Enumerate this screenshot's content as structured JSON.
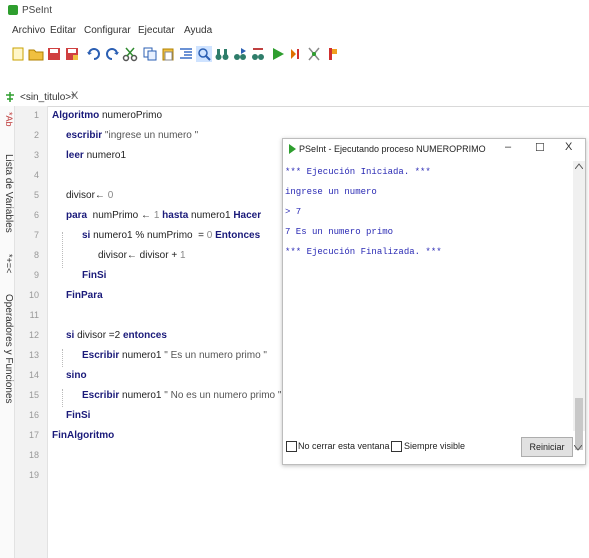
{
  "app": {
    "title": "PSeInt"
  },
  "menu": [
    "Archivo",
    "Editar",
    "Configurar",
    "Ejecutar",
    "Ayuda"
  ],
  "tab": {
    "label": "<sin_titulo>*",
    "close": "X"
  },
  "side_panels": {
    "variables": "Lista de Variables",
    "operators": "Operadores y Funciones"
  },
  "editor": {
    "line_numbers": [
      "1",
      "2",
      "3",
      "4",
      "5",
      "6",
      "7",
      "8",
      "9",
      "10",
      "11",
      "12",
      "13",
      "14",
      "15",
      "16",
      "17",
      "18",
      "19"
    ],
    "lines": [
      {
        "kw1": "Algoritmo",
        "text": " numeroPrimo"
      },
      {
        "kw1": "escribir",
        "str": " \"ingrese un numero \""
      },
      {
        "kw1": "leer",
        "text": " numero1"
      },
      {},
      {
        "text": "divisor← ",
        "num": "0"
      },
      {
        "kw1": "para",
        "text": "  numPrimo ← ",
        "num": "1",
        "kw2": " hasta",
        "text2": " numero1 ",
        "kw3": "Hacer"
      },
      {
        "kw1": "si",
        "text": " numero1 % numPrimo  = ",
        "num": "0",
        "kw2": " Entonces"
      },
      {
        "text": "divisor← divisor + ",
        "num": "1"
      },
      {
        "kw1": "FinSi"
      },
      {
        "kw1": "FinPara"
      },
      {},
      {
        "kw1": "si",
        "text": " divisor =2 ",
        "kw2": "entonces"
      },
      {
        "kw1": "Escribir",
        "text": " numero1 ",
        "str": "\" Es un numero primo \""
      },
      {
        "kw1": "sino"
      },
      {
        "kw1": "Escribir",
        "text": " numero1 ",
        "str": "\" No es un numero primo \""
      },
      {
        "kw1": "FinSi"
      },
      {
        "kw1": "FinAlgoritmo"
      }
    ]
  },
  "run_window": {
    "title": "PSeInt - Ejecutando proceso NUMEROPRIMO",
    "minimize": "–",
    "maximize": "☐",
    "close": "X",
    "console": [
      "*** Ejecución Iniciada. ***",
      "ingrese un numero",
      "> 7",
      "7 Es un numero primo",
      "*** Ejecución Finalizada. ***"
    ],
    "checkbox_keep_open": "No cerrar esta ventana",
    "checkbox_always_visible": "Siempre visible",
    "restart_label": "Reiniciar"
  },
  "colors": {
    "keyword": "#1a1a7a",
    "console_text": "#2a2ab4",
    "run_icon": "#2e9e2e"
  }
}
